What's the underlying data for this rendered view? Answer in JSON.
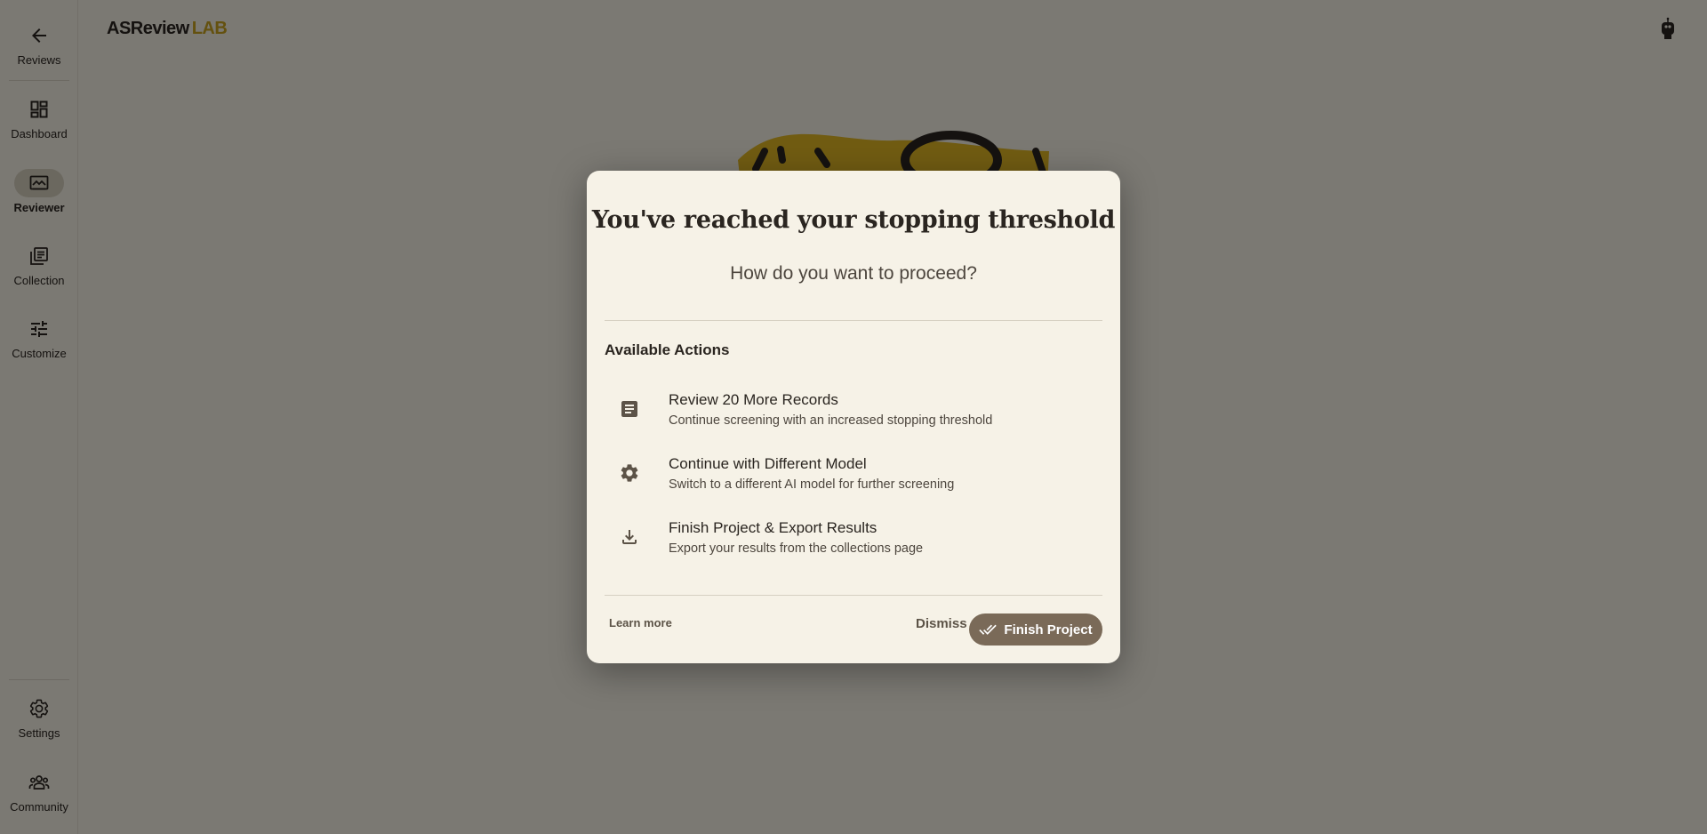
{
  "brand": {
    "main": "ASReview",
    "lab": "LAB"
  },
  "sidebar": {
    "items": [
      {
        "label": "Reviews",
        "icon": "arrow-back-icon"
      },
      {
        "label": "Dashboard",
        "icon": "dashboard-icon"
      },
      {
        "label": "Reviewer",
        "icon": "reviewer-icon",
        "active": true
      },
      {
        "label": "Collection",
        "icon": "collection-icon"
      },
      {
        "label": "Customize",
        "icon": "tune-icon"
      }
    ],
    "bottom_items": [
      {
        "label": "Settings",
        "icon": "gear-icon"
      },
      {
        "label": "Community",
        "icon": "community-icon"
      }
    ]
  },
  "dialog": {
    "title": "You've reached your stopping threshold",
    "subtitle": "How do you want to proceed?",
    "section_title": "Available Actions",
    "actions": [
      {
        "title": "Review 20 More Records",
        "description": "Continue screening with an increased stopping threshold",
        "icon": "article-icon"
      },
      {
        "title": "Continue with Different Model",
        "description": "Switch to a different AI model for further screening",
        "icon": "gear-icon"
      },
      {
        "title": "Finish Project & Export Results",
        "description": "Export your results from the collections page",
        "icon": "download-icon"
      }
    ],
    "learn_more_label": "Learn more",
    "dismiss_label": "Dismiss",
    "finish_label": "Finish Project"
  },
  "colors": {
    "background": "#f6f2e7",
    "brand_accent": "#c9a21e",
    "primary_button": "#7a6a58",
    "active_nav": "#d7d0bf"
  }
}
